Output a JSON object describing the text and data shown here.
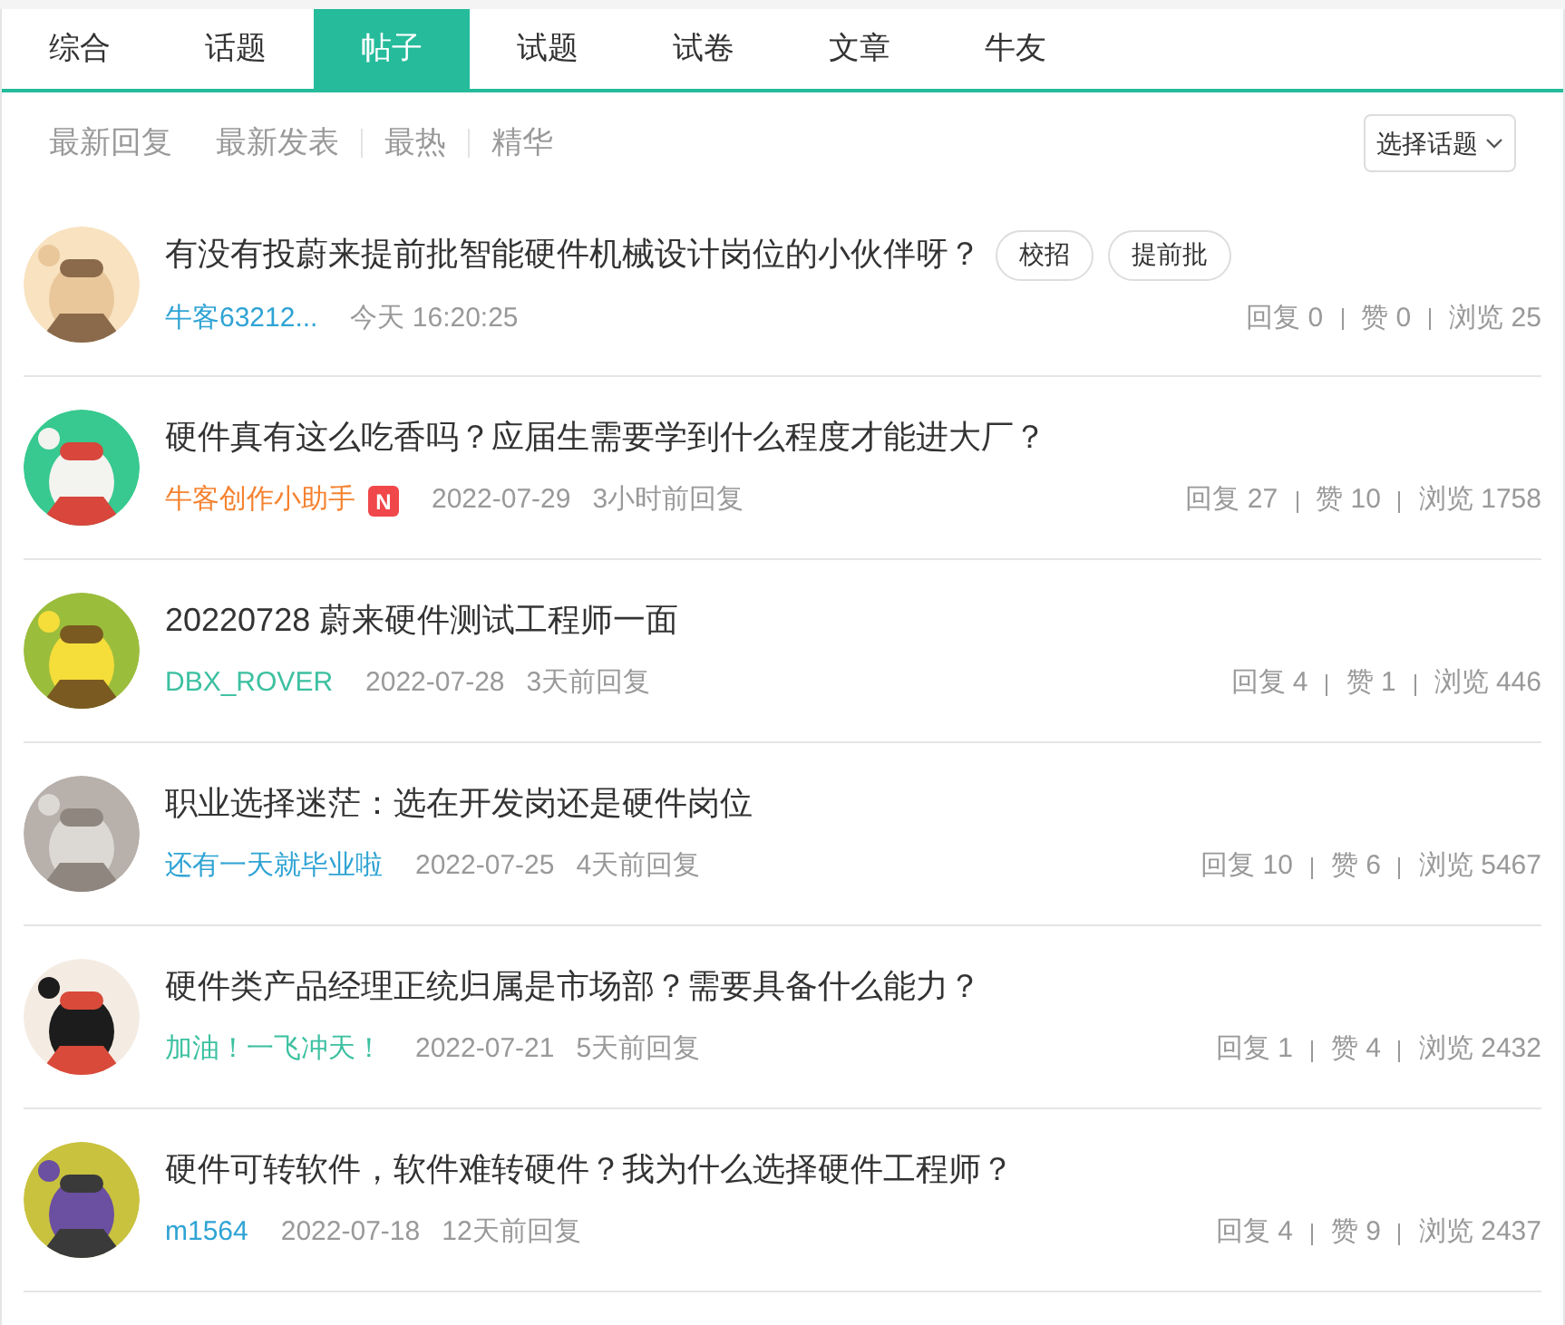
{
  "tabs": [
    {
      "label": "综合",
      "selected": false
    },
    {
      "label": "话题",
      "selected": false
    },
    {
      "label": "帖子",
      "selected": true
    },
    {
      "label": "试题",
      "selected": false
    },
    {
      "label": "试卷",
      "selected": false
    },
    {
      "label": "文章",
      "selected": false
    },
    {
      "label": "牛友",
      "selected": false
    }
  ],
  "filters": [
    {
      "label": "最新回复"
    },
    {
      "label": "最新发表"
    },
    {
      "label": "最热"
    },
    {
      "label": "精华"
    }
  ],
  "topic_select": {
    "label": "选择话题"
  },
  "posts": [
    {
      "title": "有没有投蔚来提前批智能硬件机械设计岗位的小伙伴呀？",
      "tags": [
        "校招",
        "提前批"
      ],
      "author": "牛客63212...",
      "color": "#2fa3d4",
      "date": "今天 16:20:25",
      "replies": "回复 0",
      "likes": "赞 0",
      "views": "浏览 25"
    },
    {
      "title": "硬件真有这么吃香吗？应届生需要学到什么程度才能进大厂？",
      "author": "牛客创作小助手",
      "color": "#f5822f",
      "badge": "N",
      "date": "2022-07-29",
      "last_reply": "3小时前回复",
      "replies": "回复 27",
      "likes": "赞 10",
      "views": "浏览 1758"
    },
    {
      "title": "20220728 蔚来硬件测试工程师一面",
      "author": "DBX_ROVER",
      "color": "#3cc0a0",
      "date": "2022-07-28",
      "last_reply": "3天前回复",
      "replies": "回复 4",
      "likes": "赞 1",
      "views": "浏览 446"
    },
    {
      "title": "职业选择迷茫：选在开发岗还是硬件岗位",
      "author": "还有一天就毕业啦",
      "color": "#2fa3d4",
      "date": "2022-07-25",
      "last_reply": "4天前回复",
      "replies": "回复 10",
      "likes": "赞 6",
      "views": "浏览 5467"
    },
    {
      "title": "硬件类产品经理正统归属是市场部？需要具备什么能力？",
      "author": "加油！一飞冲天！",
      "color": "#3cc0a0",
      "date": "2022-07-21",
      "last_reply": "5天前回复",
      "replies": "回复 1",
      "likes": "赞 4",
      "views": "浏览 2432"
    },
    {
      "title": "硬件可转软件，软件难转硬件？我为什么选择硬件工程师？",
      "author": "m1564",
      "color": "#2fa3d4",
      "date": "2022-07-18",
      "last_reply": "12天前回复",
      "replies": "回复 4",
      "likes": "赞 9",
      "views": "浏览 2437"
    }
  ]
}
